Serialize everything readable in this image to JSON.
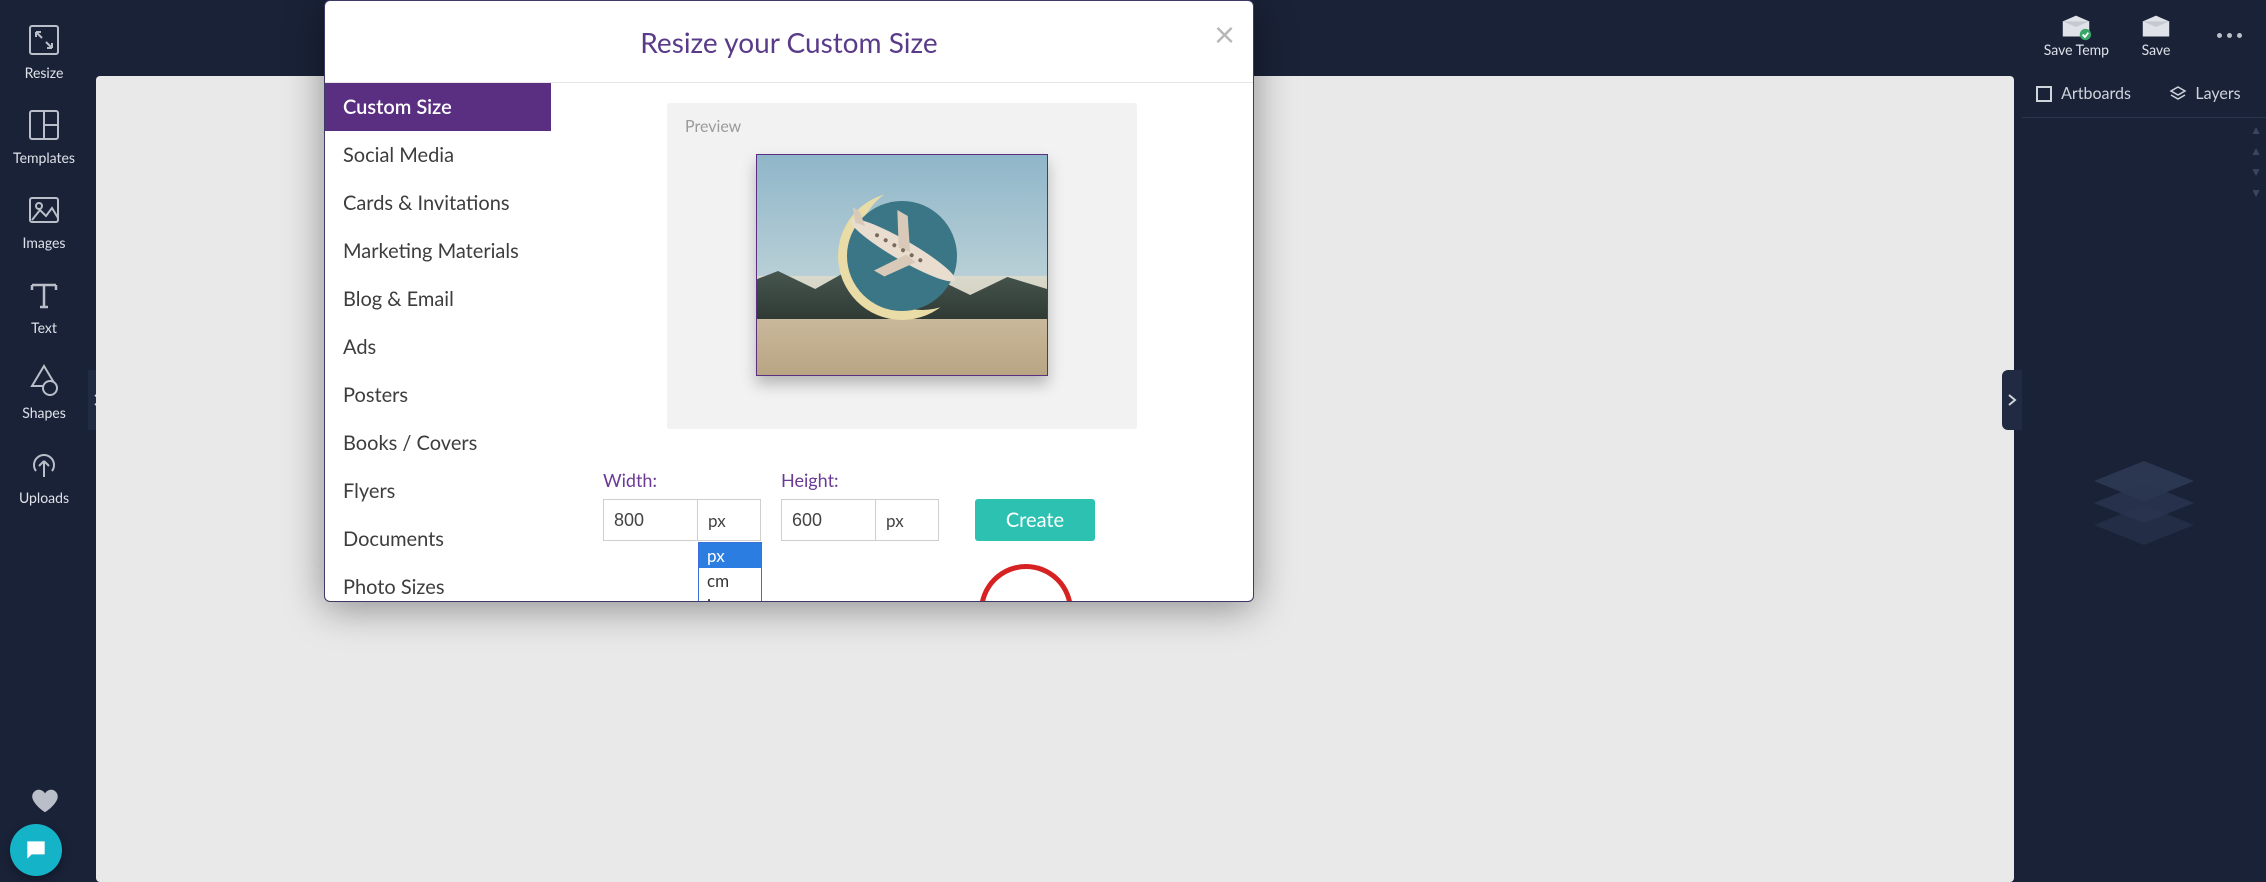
{
  "left_toolbar": {
    "items": [
      {
        "label": "Resize"
      },
      {
        "label": "Templates"
      },
      {
        "label": "Images"
      },
      {
        "label": "Text"
      },
      {
        "label": "Shapes"
      },
      {
        "label": "Uploads"
      }
    ]
  },
  "top_right": {
    "save_temp": "Save Temp",
    "save": "Save"
  },
  "right_panel": {
    "artboards": "Artboards",
    "layers": "Layers"
  },
  "modal": {
    "title": "Resize your Custom Size",
    "categories": [
      "Custom Size",
      "Social Media",
      "Cards & Invitations",
      "Marketing Materials",
      "Blog & Email",
      "Ads",
      "Posters",
      "Books / Covers",
      "Flyers",
      "Documents",
      "Photo Sizes"
    ],
    "preview_label": "Preview",
    "width_label": "Width:",
    "height_label": "Height:",
    "width_value": "800",
    "height_value": "600",
    "width_unit": "px",
    "height_unit": "px",
    "unit_options": [
      "px",
      "cm",
      "in"
    ],
    "create_label": "Create"
  }
}
